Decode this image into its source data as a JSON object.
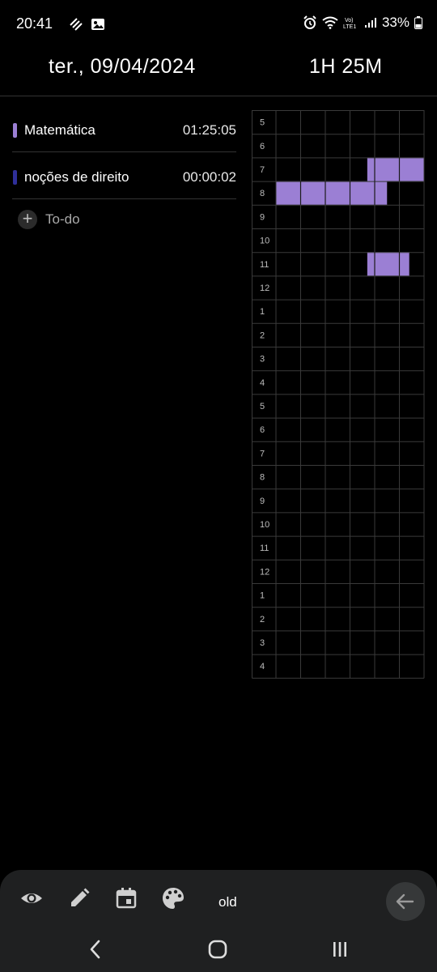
{
  "status": {
    "time": "20:41",
    "battery": "33%",
    "network": "LTE1"
  },
  "header": {
    "date": "ter., 09/04/2024",
    "total": "1H 25M"
  },
  "subjects": [
    {
      "name": "Matemática",
      "time": "01:25:05",
      "color": "#9b7fd4"
    },
    {
      "name": "noções de direito",
      "time": "00:00:02",
      "color": "#2f2f9a"
    }
  ],
  "todo": {
    "label": "To-do"
  },
  "timetable": {
    "hours": [
      "5",
      "6",
      "7",
      "8",
      "9",
      "10",
      "11",
      "12",
      "1",
      "2",
      "3",
      "4",
      "5",
      "6",
      "7",
      "8",
      "9",
      "10",
      "11",
      "12",
      "1",
      "2",
      "3",
      "4"
    ],
    "block_color": "#9b7fd4"
  },
  "toolbar": {
    "label": "old",
    "icons": [
      "eye-icon",
      "pencil-icon",
      "calendar-icon",
      "palette-icon",
      "arrow-left-icon"
    ]
  },
  "navbar": {
    "icons": [
      "back-chevron-icon",
      "home-icon",
      "recents-icon"
    ]
  }
}
